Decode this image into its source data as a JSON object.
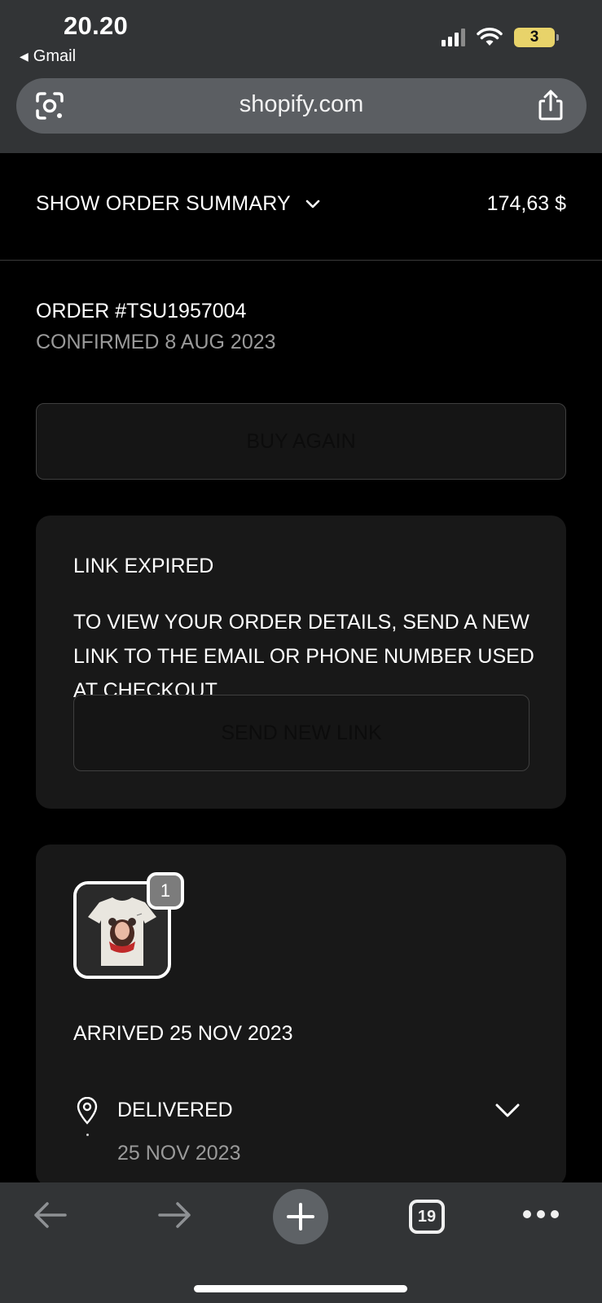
{
  "status_bar": {
    "time": "20.20",
    "back_app": "Gmail",
    "battery": "3"
  },
  "browser": {
    "url": "shopify.com",
    "tab_count": "19"
  },
  "order_summary": {
    "label": "SHOW ORDER SUMMARY",
    "total": "174,63 $"
  },
  "order": {
    "number": "ORDER #TSU1957004",
    "confirmed": "CONFIRMED 8 AUG 2023",
    "buy_again": "BUY AGAIN"
  },
  "link_card": {
    "title": "LINK EXPIRED",
    "body": "TO VIEW YOUR ORDER DETAILS, SEND A NEW LINK TO THE EMAIL OR PHONE NUMBER USED AT CHECKOUT.",
    "button": "SEND NEW LINK"
  },
  "shipment": {
    "quantity": "1",
    "arrived": "ARRIVED 25 NOV 2023",
    "status": "DELIVERED",
    "status_date": "25 NOV 2023"
  },
  "colors": {
    "chrome_bg": "#323436",
    "page_bg": "#000000",
    "card_bg": "#181818",
    "muted_text": "#9a9a9a",
    "battery": "#e8d36a"
  }
}
